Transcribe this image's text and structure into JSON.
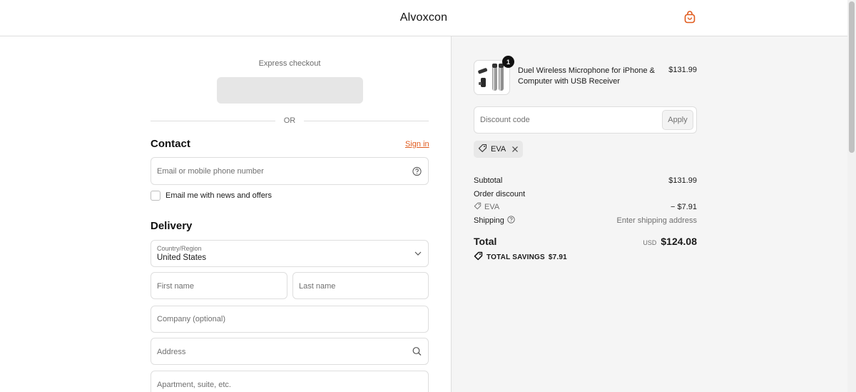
{
  "header": {
    "brand": "Alvoxcon",
    "cart_icon": "shopping-bag-icon",
    "accent_color": "#e05a1c"
  },
  "express": {
    "label": "Express checkout",
    "divider": "OR"
  },
  "contact": {
    "title": "Contact",
    "sign_in": "Sign in",
    "email_placeholder": "Email or mobile phone number",
    "newsletter_label": "Email me with news and offers",
    "newsletter_checked": false
  },
  "delivery": {
    "title": "Delivery",
    "country_label": "Country/Region",
    "country_value": "United States",
    "first_name_placeholder": "First name",
    "last_name_placeholder": "Last name",
    "company_placeholder": "Company (optional)",
    "address_placeholder": "Address",
    "apartment_placeholder": "Apartment, suite, etc."
  },
  "order": {
    "product": {
      "name": "Duel Wireless Microphone for iPhone & Computer with USB Receiver",
      "price": "$131.99",
      "quantity": "1"
    },
    "discount": {
      "placeholder": "Discount code",
      "apply_label": "Apply",
      "applied_code": "EVA"
    },
    "summary": {
      "subtotal_label": "Subtotal",
      "subtotal_value": "$131.99",
      "order_discount_label": "Order discount",
      "discount_code": "EVA",
      "discount_value": "− $7.91",
      "shipping_label": "Shipping",
      "shipping_value": "Enter shipping address",
      "total_label": "Total",
      "total_currency": "USD",
      "total_value": "$124.08",
      "savings_label": "TOTAL SAVINGS",
      "savings_value": "$7.91"
    }
  }
}
